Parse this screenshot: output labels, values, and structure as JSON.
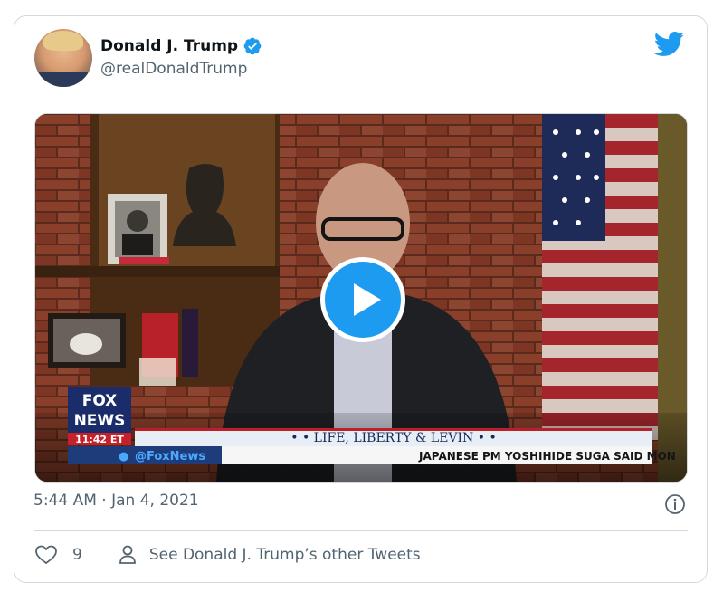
{
  "tweet": {
    "author": {
      "display_name": "Donald J. Trump",
      "handle": "@realDonaldTrump",
      "verified": true,
      "avatar": "profile-photo"
    },
    "timestamp": "5:44 AM · Jan 4, 2021",
    "likes": "9",
    "other_tweets_label": "See Donald J. Trump’s other Tweets"
  },
  "media": {
    "type": "video",
    "network_logo_line1": "FOX",
    "network_logo_line2": "NEWS",
    "clock": "11:42 ET",
    "show_title": "• • LIFE, LIBERTY & LEVIN • •",
    "ticker_handle": "@FoxNews",
    "ticker_text": "JAPANESE PM YOSHIHIDE SUGA SAID MON"
  },
  "icons": {
    "brand": "twitter-bird-icon",
    "verified": "verified-badge-icon",
    "play": "play-icon",
    "info": "info-icon",
    "like": "heart-icon",
    "person": "person-icon"
  },
  "colors": {
    "brand_blue": "#1d9bf0",
    "text_primary": "#0f1419",
    "text_secondary": "#536471",
    "border": "#cfd9de"
  }
}
